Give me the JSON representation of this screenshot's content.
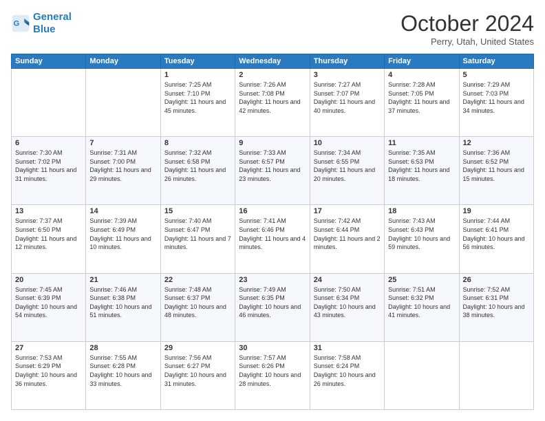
{
  "header": {
    "logo_line1": "General",
    "logo_line2": "Blue",
    "month_title": "October 2024",
    "location": "Perry, Utah, United States"
  },
  "days_of_week": [
    "Sunday",
    "Monday",
    "Tuesday",
    "Wednesday",
    "Thursday",
    "Friday",
    "Saturday"
  ],
  "weeks": [
    [
      {
        "day": "",
        "info": ""
      },
      {
        "day": "",
        "info": ""
      },
      {
        "day": "1",
        "info": "Sunrise: 7:25 AM\nSunset: 7:10 PM\nDaylight: 11 hours and 45 minutes."
      },
      {
        "day": "2",
        "info": "Sunrise: 7:26 AM\nSunset: 7:08 PM\nDaylight: 11 hours and 42 minutes."
      },
      {
        "day": "3",
        "info": "Sunrise: 7:27 AM\nSunset: 7:07 PM\nDaylight: 11 hours and 40 minutes."
      },
      {
        "day": "4",
        "info": "Sunrise: 7:28 AM\nSunset: 7:05 PM\nDaylight: 11 hours and 37 minutes."
      },
      {
        "day": "5",
        "info": "Sunrise: 7:29 AM\nSunset: 7:03 PM\nDaylight: 11 hours and 34 minutes."
      }
    ],
    [
      {
        "day": "6",
        "info": "Sunrise: 7:30 AM\nSunset: 7:02 PM\nDaylight: 11 hours and 31 minutes."
      },
      {
        "day": "7",
        "info": "Sunrise: 7:31 AM\nSunset: 7:00 PM\nDaylight: 11 hours and 29 minutes."
      },
      {
        "day": "8",
        "info": "Sunrise: 7:32 AM\nSunset: 6:58 PM\nDaylight: 11 hours and 26 minutes."
      },
      {
        "day": "9",
        "info": "Sunrise: 7:33 AM\nSunset: 6:57 PM\nDaylight: 11 hours and 23 minutes."
      },
      {
        "day": "10",
        "info": "Sunrise: 7:34 AM\nSunset: 6:55 PM\nDaylight: 11 hours and 20 minutes."
      },
      {
        "day": "11",
        "info": "Sunrise: 7:35 AM\nSunset: 6:53 PM\nDaylight: 11 hours and 18 minutes."
      },
      {
        "day": "12",
        "info": "Sunrise: 7:36 AM\nSunset: 6:52 PM\nDaylight: 11 hours and 15 minutes."
      }
    ],
    [
      {
        "day": "13",
        "info": "Sunrise: 7:37 AM\nSunset: 6:50 PM\nDaylight: 11 hours and 12 minutes."
      },
      {
        "day": "14",
        "info": "Sunrise: 7:39 AM\nSunset: 6:49 PM\nDaylight: 11 hours and 10 minutes."
      },
      {
        "day": "15",
        "info": "Sunrise: 7:40 AM\nSunset: 6:47 PM\nDaylight: 11 hours and 7 minutes."
      },
      {
        "day": "16",
        "info": "Sunrise: 7:41 AM\nSunset: 6:46 PM\nDaylight: 11 hours and 4 minutes."
      },
      {
        "day": "17",
        "info": "Sunrise: 7:42 AM\nSunset: 6:44 PM\nDaylight: 11 hours and 2 minutes."
      },
      {
        "day": "18",
        "info": "Sunrise: 7:43 AM\nSunset: 6:43 PM\nDaylight: 10 hours and 59 minutes."
      },
      {
        "day": "19",
        "info": "Sunrise: 7:44 AM\nSunset: 6:41 PM\nDaylight: 10 hours and 56 minutes."
      }
    ],
    [
      {
        "day": "20",
        "info": "Sunrise: 7:45 AM\nSunset: 6:39 PM\nDaylight: 10 hours and 54 minutes."
      },
      {
        "day": "21",
        "info": "Sunrise: 7:46 AM\nSunset: 6:38 PM\nDaylight: 10 hours and 51 minutes."
      },
      {
        "day": "22",
        "info": "Sunrise: 7:48 AM\nSunset: 6:37 PM\nDaylight: 10 hours and 48 minutes."
      },
      {
        "day": "23",
        "info": "Sunrise: 7:49 AM\nSunset: 6:35 PM\nDaylight: 10 hours and 46 minutes."
      },
      {
        "day": "24",
        "info": "Sunrise: 7:50 AM\nSunset: 6:34 PM\nDaylight: 10 hours and 43 minutes."
      },
      {
        "day": "25",
        "info": "Sunrise: 7:51 AM\nSunset: 6:32 PM\nDaylight: 10 hours and 41 minutes."
      },
      {
        "day": "26",
        "info": "Sunrise: 7:52 AM\nSunset: 6:31 PM\nDaylight: 10 hours and 38 minutes."
      }
    ],
    [
      {
        "day": "27",
        "info": "Sunrise: 7:53 AM\nSunset: 6:29 PM\nDaylight: 10 hours and 36 minutes."
      },
      {
        "day": "28",
        "info": "Sunrise: 7:55 AM\nSunset: 6:28 PM\nDaylight: 10 hours and 33 minutes."
      },
      {
        "day": "29",
        "info": "Sunrise: 7:56 AM\nSunset: 6:27 PM\nDaylight: 10 hours and 31 minutes."
      },
      {
        "day": "30",
        "info": "Sunrise: 7:57 AM\nSunset: 6:26 PM\nDaylight: 10 hours and 28 minutes."
      },
      {
        "day": "31",
        "info": "Sunrise: 7:58 AM\nSunset: 6:24 PM\nDaylight: 10 hours and 26 minutes."
      },
      {
        "day": "",
        "info": ""
      },
      {
        "day": "",
        "info": ""
      }
    ]
  ]
}
